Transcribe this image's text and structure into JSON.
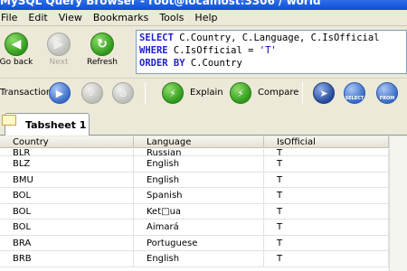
{
  "window": {
    "title": "MySQL Query Browser - root@localhost:3306 / world"
  },
  "menu": [
    "File",
    "Edit",
    "View",
    "Bookmarks",
    "Tools",
    "Help"
  ],
  "nav": {
    "back_label": "Go back",
    "next_label": "Next",
    "refresh_label": "Refresh"
  },
  "sql": {
    "line1_kw": "SELECT",
    "line1_rest": " C.Country, C.Language, C.IsOfficial",
    "line2_kw": "WHERE",
    "line2_rest": " C.IsOfficial = ",
    "line2_str": "'T'",
    "line3_kw": "ORDER BY",
    "line3_rest": " C.Country"
  },
  "toolbar": {
    "transaction_label": "Transaction",
    "explain_label": "Explain",
    "compare_label": "Compare",
    "select_label": "SELECT",
    "from_label": "FROM"
  },
  "tabs": [
    {
      "label": "Tabsheet 1"
    }
  ],
  "table": {
    "columns": [
      "Country",
      "Language",
      "IsOfficial"
    ],
    "rows": [
      [
        "BLR",
        "Russian",
        "T"
      ],
      [
        "BLZ",
        "English",
        "T"
      ],
      [
        "BMU",
        "English",
        "T"
      ],
      [
        "BOL",
        "Spanish",
        "T"
      ],
      [
        "BOL",
        "Ket□ua",
        "T"
      ],
      [
        "BOL",
        "Aimará",
        "T"
      ],
      [
        "BRA",
        "Portuguese",
        "T"
      ],
      [
        "BRB",
        "English",
        "T"
      ]
    ]
  }
}
